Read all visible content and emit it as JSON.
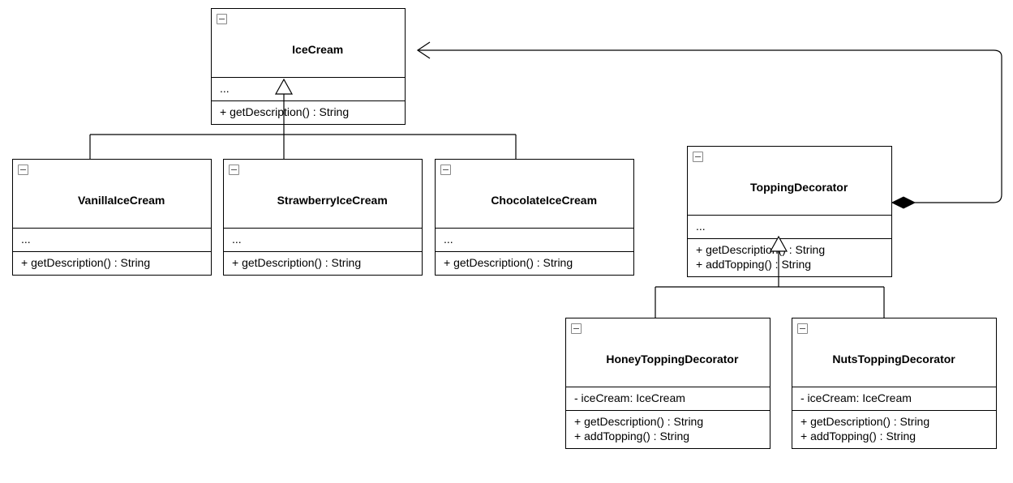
{
  "classes": {
    "IceCream": {
      "name": "IceCream",
      "attrs": "...",
      "ops": "+ getDescription() : String"
    },
    "VanillaIceCream": {
      "name": "VanillaIceCream",
      "attrs": "...",
      "ops": "+ getDescription() : String"
    },
    "StrawberryIceCream": {
      "name": "StrawberryIceCream",
      "attrs": "...",
      "ops": "+ getDescription() : String"
    },
    "ChocolateIceCream": {
      "name": "ChocolateIceCream",
      "attrs": "...",
      "ops": "+ getDescription() : String"
    },
    "ToppingDecorator": {
      "name": "ToppingDecorator",
      "attrs": "...",
      "ops": "+ getDescription() : String\n+ addTopping() : String"
    },
    "HoneyToppingDecorator": {
      "name": "HoneyToppingDecorator",
      "attrs": "- iceCream: IceCream",
      "ops": "+ getDescription() : String\n+ addTopping() : String"
    },
    "NutsToppingDecorator": {
      "name": "NutsToppingDecorator",
      "attrs": "- iceCream: IceCream",
      "ops": "+ getDescription() : String\n+ addTopping() : String"
    }
  },
  "relationships": {
    "inheritance": [
      {
        "from": "VanillaIceCream",
        "to": "IceCream"
      },
      {
        "from": "StrawberryIceCream",
        "to": "IceCream"
      },
      {
        "from": "ChocolateIceCream",
        "to": "IceCream"
      },
      {
        "from": "HoneyToppingDecorator",
        "to": "ToppingDecorator"
      },
      {
        "from": "NutsToppingDecorator",
        "to": "ToppingDecorator"
      }
    ],
    "composition_with_reference": [
      {
        "from": "ToppingDecorator",
        "to": "IceCream",
        "arrow_end": "IceCream",
        "diamond_end": "ToppingDecorator"
      }
    ]
  }
}
